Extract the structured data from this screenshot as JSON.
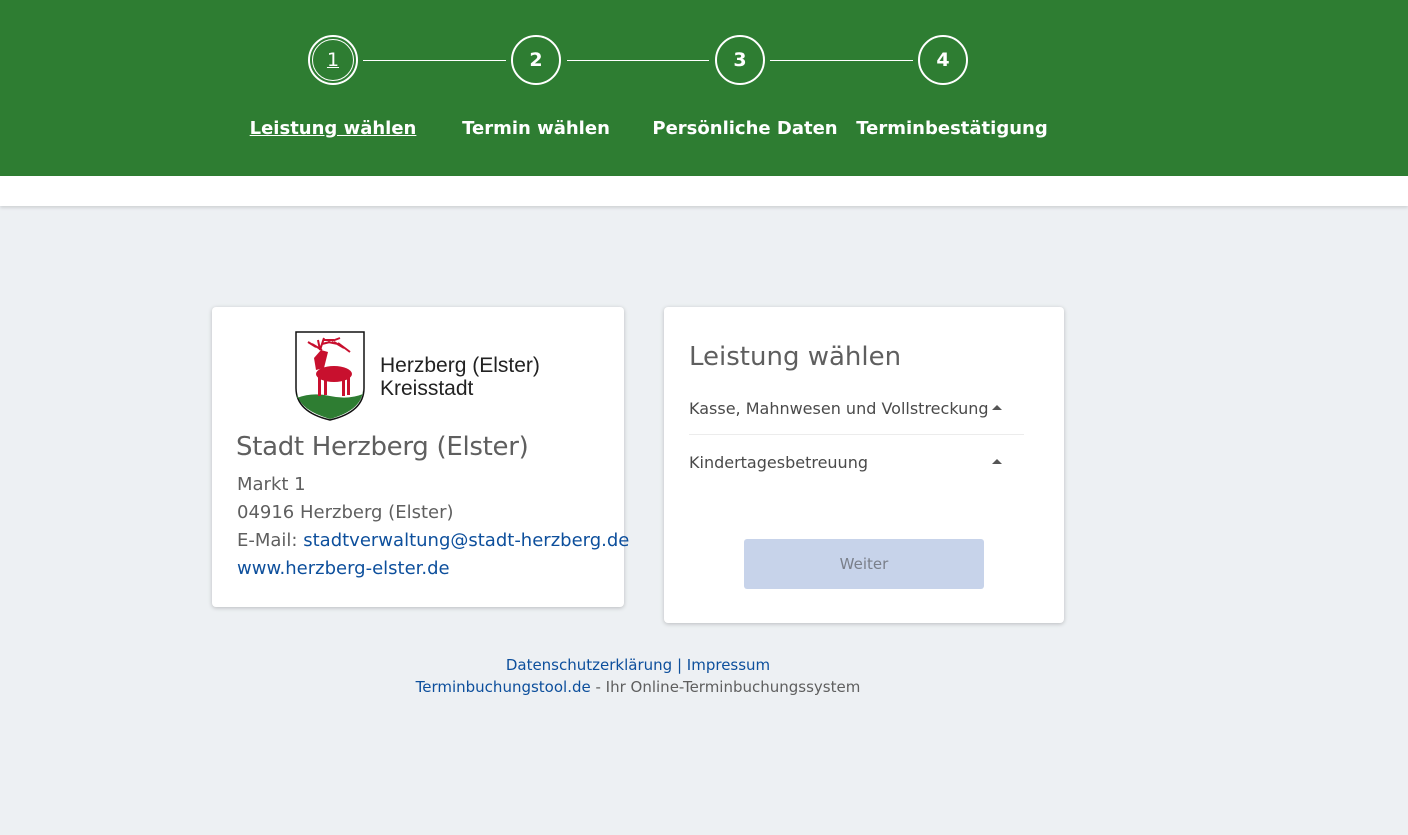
{
  "stepper": {
    "steps": [
      {
        "number": "1",
        "label": "Leistung wählen",
        "active": true
      },
      {
        "number": "2",
        "label": "Termin wählen",
        "active": false
      },
      {
        "number": "3",
        "label": "Persönliche Daten",
        "active": false
      },
      {
        "number": "4",
        "label": "Terminbestätigung",
        "active": false
      }
    ]
  },
  "org": {
    "logo_line1": "Herzberg (Elster)",
    "logo_line2": "Kreisstadt",
    "name": "Stadt Herzberg (Elster)",
    "street": "Markt 1",
    "city": "04916 Herzberg (Elster)",
    "email_label": "E-Mail:",
    "email": "stadtverwaltung@stadt-herzberg.de",
    "website": "www.herzberg-elster.de"
  },
  "service_panel": {
    "title": "Leistung wählen",
    "categories": [
      {
        "label": "Kasse, Mahnwesen und Vollstreckung",
        "icon": "caret-up-icon"
      },
      {
        "label": "Kindertagesbetreuung",
        "icon": "caret-up-icon"
      }
    ],
    "next_label": "Weiter"
  },
  "footer": {
    "privacy": "Datenschutzerklärung",
    "separator": "|",
    "imprint": "Impressum",
    "tool_link": "Terminbuchungstool.de",
    "tool_suffix": " - Ihr Online-Terminbuchungssystem"
  },
  "colors": {
    "header": "#2e7d32",
    "background": "#edf0f3",
    "link": "#0d4f9c",
    "button_disabled": "#c7d3ea",
    "coat_red": "#c8102e",
    "coat_green": "#2e7d32"
  }
}
